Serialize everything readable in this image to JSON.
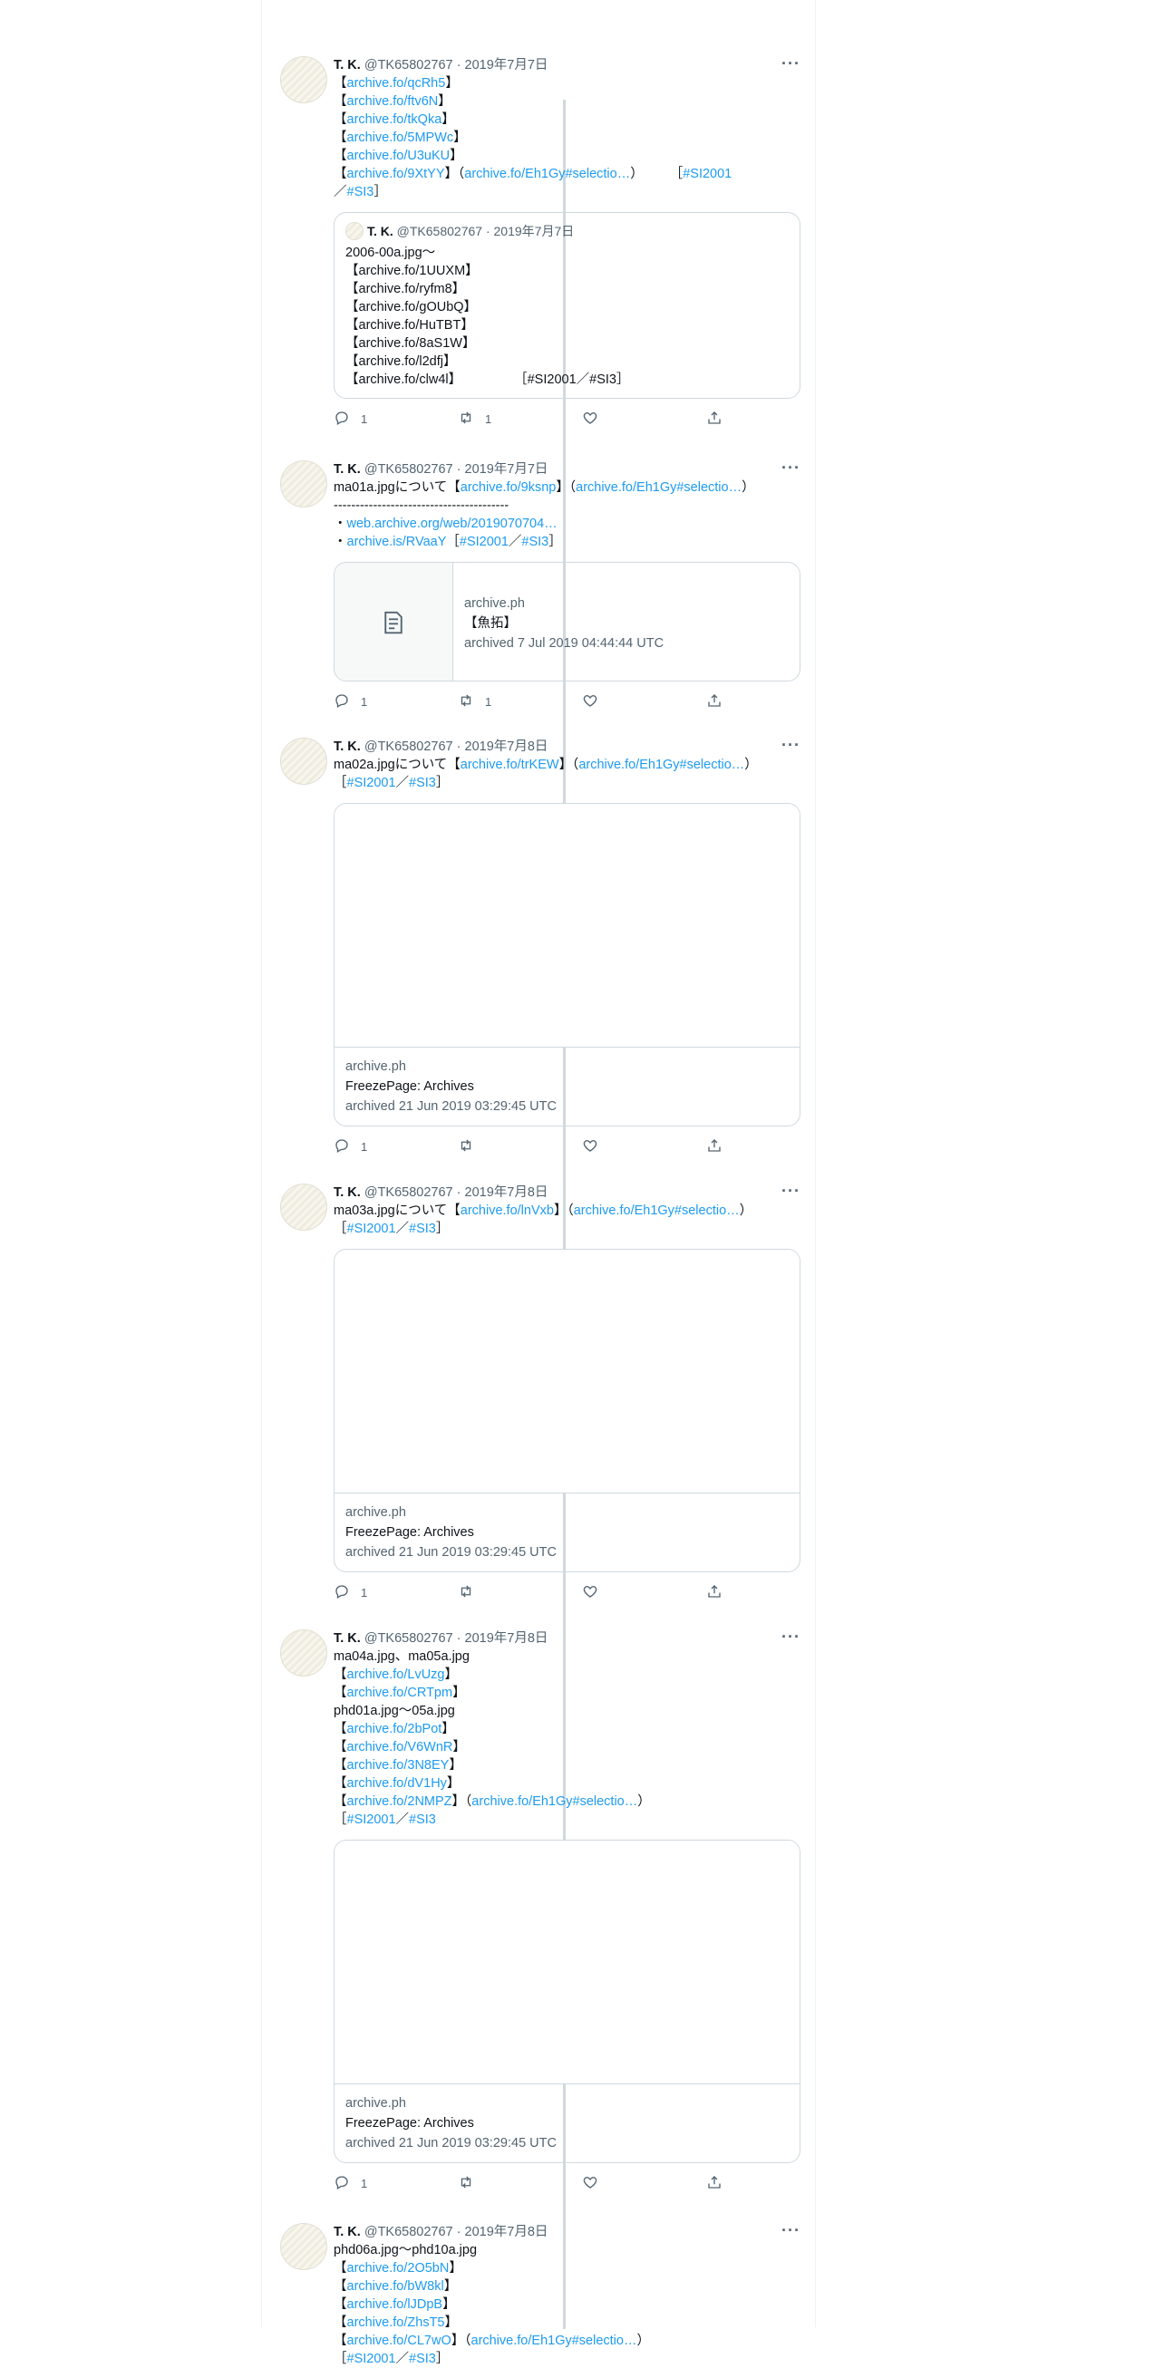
{
  "user": {
    "name": "T. K.",
    "handle": "@TK65802767"
  },
  "tweets": [
    {
      "date": "2019年7月7日",
      "segments": [
        {
          "t": "【"
        },
        {
          "t": "archive.fo/qcRh5",
          "l": 1
        },
        {
          "t": "】\n【"
        },
        {
          "t": "archive.fo/ftv6N",
          "l": 1
        },
        {
          "t": "】\n【"
        },
        {
          "t": "archive.fo/tkQka",
          "l": 1
        },
        {
          "t": "】\n【"
        },
        {
          "t": "archive.fo/5MPWc",
          "l": 1
        },
        {
          "t": "】\n【"
        },
        {
          "t": "archive.fo/U3uKU",
          "l": 1
        },
        {
          "t": "】\n【"
        },
        {
          "t": "archive.fo/9XtYY",
          "l": 1
        },
        {
          "t": "】（"
        },
        {
          "t": "archive.fo/Eh1Gy#selectio…",
          "l": 1
        },
        {
          "t": "）　　　［"
        },
        {
          "t": "#SI2001",
          "l": 1
        },
        {
          "t": "\n／"
        },
        {
          "t": "#SI3",
          "l": 1
        },
        {
          "t": "］"
        }
      ],
      "quote": {
        "name": "T. K.",
        "handle": "@TK65802767",
        "date": "2019年7月7日",
        "text": "2006-00a.jpg～\n【archive.fo/1UUXM】\n【archive.fo/ryfm8】\n【archive.fo/gOUbQ】\n【archive.fo/HuTBT】\n【archive.fo/8aS1W】\n【archive.fo/l2dfj】\n【archive.fo/clw4l】　　　　　［#SI2001／#SI3］"
      },
      "counts": {
        "reply": "1",
        "retweet": "1",
        "like": "",
        "share": ""
      }
    },
    {
      "date": "2019年7月7日",
      "segments": [
        {
          "t": "ma01a.jpgについて【"
        },
        {
          "t": "archive.fo/9ksnp",
          "l": 1
        },
        {
          "t": "】（"
        },
        {
          "t": "archive.fo/Eh1Gy#selectio…",
          "l": 1
        },
        {
          "t": "）\n----------------------------------------\n・"
        },
        {
          "t": "web.archive.org/web/2019070704…",
          "l": 1
        },
        {
          "t": "\n・"
        },
        {
          "t": "archive.is/RVaaY",
          "l": 1
        },
        {
          "t": "［"
        },
        {
          "t": "#SI2001",
          "l": 1
        },
        {
          "t": "／"
        },
        {
          "t": "#SI3",
          "l": 1
        },
        {
          "t": "］"
        }
      ],
      "card": {
        "type": "small",
        "domain": "archive.ph",
        "title": "【魚拓】",
        "desc": "archived 7 Jul 2019 04:44:44 UTC"
      },
      "counts": {
        "reply": "1",
        "retweet": "1",
        "like": "",
        "share": ""
      }
    },
    {
      "date": "2019年7月8日",
      "segments": [
        {
          "t": "ma02a.jpgについて【"
        },
        {
          "t": "archive.fo/trKEW",
          "l": 1
        },
        {
          "t": "】（"
        },
        {
          "t": "archive.fo/Eh1Gy#selectio…",
          "l": 1
        },
        {
          "t": "）\n［"
        },
        {
          "t": "#SI2001",
          "l": 1
        },
        {
          "t": "／"
        },
        {
          "t": "#SI3",
          "l": 1
        },
        {
          "t": "］"
        }
      ],
      "card": {
        "type": "large",
        "domain": "archive.ph",
        "title": "FreezePage: Archives",
        "desc": "archived 21 Jun 2019 03:29:45 UTC"
      },
      "counts": {
        "reply": "1",
        "retweet": "",
        "like": "",
        "share": ""
      }
    },
    {
      "date": "2019年7月8日",
      "segments": [
        {
          "t": "ma03a.jpgについて【"
        },
        {
          "t": "archive.fo/lnVxb",
          "l": 1
        },
        {
          "t": "】（"
        },
        {
          "t": "archive.fo/Eh1Gy#selectio…",
          "l": 1
        },
        {
          "t": "）\n［"
        },
        {
          "t": "#SI2001",
          "l": 1
        },
        {
          "t": "／"
        },
        {
          "t": "#SI3",
          "l": 1
        },
        {
          "t": "］"
        }
      ],
      "card": {
        "type": "large",
        "domain": "archive.ph",
        "title": "FreezePage: Archives",
        "desc": "archived 21 Jun 2019 03:29:45 UTC"
      },
      "counts": {
        "reply": "1",
        "retweet": "",
        "like": "",
        "share": ""
      }
    },
    {
      "date": "2019年7月8日",
      "segments": [
        {
          "t": "ma04a.jpg、ma05a.jpg\n【"
        },
        {
          "t": "archive.fo/LvUzg",
          "l": 1
        },
        {
          "t": "】\n【"
        },
        {
          "t": "archive.fo/CRTpm",
          "l": 1
        },
        {
          "t": "】\nphd01a.jpg～05a.jpg\n【"
        },
        {
          "t": "archive.fo/2bPot",
          "l": 1
        },
        {
          "t": "】\n【"
        },
        {
          "t": "archive.fo/V6WnR",
          "l": 1
        },
        {
          "t": "】\n【"
        },
        {
          "t": "archive.fo/3N8EY",
          "l": 1
        },
        {
          "t": "】\n【"
        },
        {
          "t": "archive.fo/dV1Hy",
          "l": 1
        },
        {
          "t": "】\n【"
        },
        {
          "t": "archive.fo/2NMPZ",
          "l": 1
        },
        {
          "t": "】（"
        },
        {
          "t": "archive.fo/Eh1Gy#selectio…",
          "l": 1
        },
        {
          "t": "）\n［"
        },
        {
          "t": "#SI2001",
          "l": 1
        },
        {
          "t": "／"
        },
        {
          "t": "#SI3",
          "l": 1
        }
      ],
      "card": {
        "type": "large",
        "domain": "archive.ph",
        "title": "FreezePage: Archives",
        "desc": "archived 21 Jun 2019 03:29:45 UTC"
      },
      "counts": {
        "reply": "1",
        "retweet": "",
        "like": "",
        "share": ""
      }
    },
    {
      "date": "2019年7月8日",
      "segments": [
        {
          "t": "phd06a.jpg～phd10a.jpg\n【"
        },
        {
          "t": "archive.fo/2O5bN",
          "l": 1
        },
        {
          "t": "】\n【"
        },
        {
          "t": "archive.fo/bW8kl",
          "l": 1
        },
        {
          "t": "】\n【"
        },
        {
          "t": "archive.fo/lJDpB",
          "l": 1
        },
        {
          "t": "】\n【"
        },
        {
          "t": "archive.fo/ZhsT5",
          "l": 1
        },
        {
          "t": "】\n【"
        },
        {
          "t": "archive.fo/CL7wO",
          "l": 1
        },
        {
          "t": "】（"
        },
        {
          "t": "archive.fo/Eh1Gy#selectio…",
          "l": 1
        },
        {
          "t": "）\n［"
        },
        {
          "t": "#SI2001",
          "l": 1
        },
        {
          "t": "／"
        },
        {
          "t": "#SI3",
          "l": 1
        },
        {
          "t": "］"
        }
      ]
    }
  ]
}
